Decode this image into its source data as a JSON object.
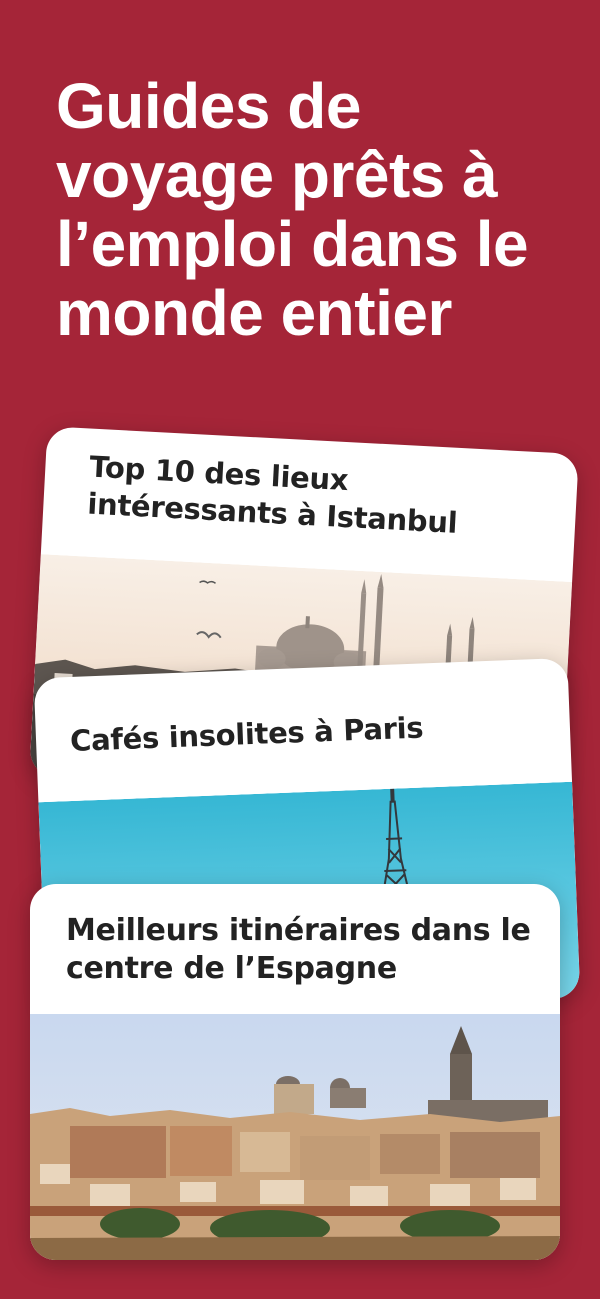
{
  "headline": "Guides de voyage prêts à l’emploi dans le monde entier",
  "colors": {
    "background": "#a52538",
    "card": "#ffffff",
    "text_dark": "#222222"
  },
  "cards": [
    {
      "title": "Top 10 des lieux intéressants à Istanbul",
      "image": "istanbul-skyline-photo"
    },
    {
      "title": "Cafés insolites à Paris",
      "image": "paris-eiffel-tower-photo"
    },
    {
      "title": "Meilleurs itinéraires dans le centre de l’Espagne",
      "image": "toledo-spain-photo"
    }
  ]
}
